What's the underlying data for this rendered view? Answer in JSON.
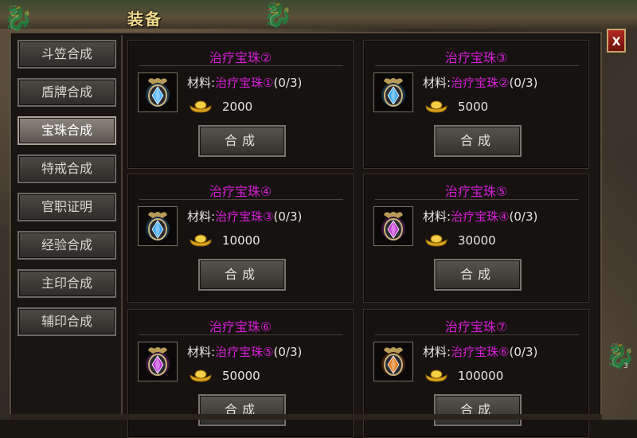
{
  "window": {
    "title": "装备",
    "close_label": "X",
    "scroll_marker": "3"
  },
  "menu": {
    "items": [
      {
        "label": "斗笠合成",
        "active": false
      },
      {
        "label": "盾牌合成",
        "active": false
      },
      {
        "label": "宝珠合成",
        "active": true
      },
      {
        "label": "特戒合成",
        "active": false
      },
      {
        "label": "官职证明",
        "active": false
      },
      {
        "label": "经验合成",
        "active": false
      },
      {
        "label": "主印合成",
        "active": false
      },
      {
        "label": "辅印合成",
        "active": false
      }
    ]
  },
  "recipes": [
    {
      "name": "治疗宝珠②",
      "mat_prefix": "材料:",
      "material": "治疗宝珠①",
      "progress": "(0/3)",
      "cost": "2000",
      "craft_label": "合成",
      "gem_color": "#4fb7ff"
    },
    {
      "name": "治疗宝珠③",
      "mat_prefix": "材料:",
      "material": "治疗宝珠②",
      "progress": "(0/3)",
      "cost": "5000",
      "craft_label": "合成",
      "gem_color": "#3aa6f0"
    },
    {
      "name": "治疗宝珠④",
      "mat_prefix": "材料:",
      "material": "治疗宝珠③",
      "progress": "(0/3)",
      "cost": "10000",
      "craft_label": "合成",
      "gem_color": "#3aa6f0"
    },
    {
      "name": "治疗宝珠⑤",
      "mat_prefix": "材料:",
      "material": "治疗宝珠④",
      "progress": "(0/3)",
      "cost": "30000",
      "craft_label": "合成",
      "gem_color": "#c23bd6"
    },
    {
      "name": "治疗宝珠⑥",
      "mat_prefix": "材料:",
      "material": "治疗宝珠⑤",
      "progress": "(0/3)",
      "cost": "50000",
      "craft_label": "合成",
      "gem_color": "#c23bd6"
    },
    {
      "name": "治疗宝珠⑦",
      "mat_prefix": "材料:",
      "material": "治疗宝珠⑥",
      "progress": "(0/3)",
      "cost": "100000",
      "craft_label": "合成",
      "gem_color": "#e0791c"
    }
  ],
  "colors": {
    "accent": "#d61fd6",
    "title": "#f0d78a",
    "gold": "#e8b830"
  }
}
